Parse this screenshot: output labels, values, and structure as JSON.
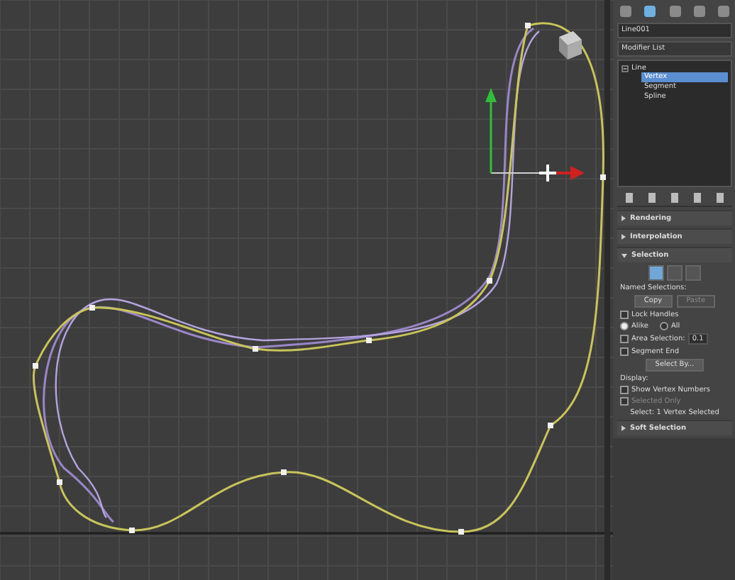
{
  "object_name": {
    "value": "Line001"
  },
  "modifier_list": {
    "label": "Modifier List"
  },
  "stack": [
    {
      "label": "Line",
      "expanded": true,
      "children": [
        {
          "label": "Vertex",
          "selected": true
        },
        {
          "label": "Segment",
          "selected": false
        },
        {
          "label": "Spline",
          "selected": false
        }
      ]
    }
  ],
  "rollouts": [
    {
      "title": "Rendering",
      "expanded": false
    },
    {
      "title": "Interpolation",
      "expanded": false
    },
    {
      "title": "Selection",
      "expanded": true,
      "items": [
        {
          "kind": "icons",
          "icons": [
            {
              "selected": true
            },
            {
              "selected": false
            },
            {
              "selected": false
            }
          ]
        },
        {
          "kind": "label",
          "text": "Named Selections:"
        },
        {
          "kind": "buttons",
          "buttons": [
            {
              "label": "Copy",
              "disabled": false
            },
            {
              "label": "Paste",
              "disabled": true
            }
          ]
        },
        {
          "kind": "checkbox",
          "label": "Lock Handles",
          "checked": false,
          "disabled": false
        },
        {
          "kind": "radios",
          "options": [
            {
              "label": "Alike",
              "selected": true
            },
            {
              "label": "All",
              "selected": false
            }
          ]
        },
        {
          "kind": "spinner",
          "label": "Area Selection:",
          "checked": false,
          "value": "0.1"
        },
        {
          "kind": "checkbox",
          "label": "Segment End",
          "checked": false,
          "disabled": false
        },
        {
          "kind": "button",
          "label": "Select By..."
        },
        {
          "kind": "label",
          "text": "Display:"
        },
        {
          "kind": "checkbox",
          "label": "Show Vertex Numbers",
          "checked": false,
          "disabled": false
        },
        {
          "kind": "checkbox",
          "label": "Selected Only",
          "checked": false,
          "disabled": true
        },
        {
          "kind": "status",
          "text": "Select: 1 Vertex Selected"
        }
      ]
    },
    {
      "title": "Soft Selection",
      "expanded": false
    }
  ]
}
